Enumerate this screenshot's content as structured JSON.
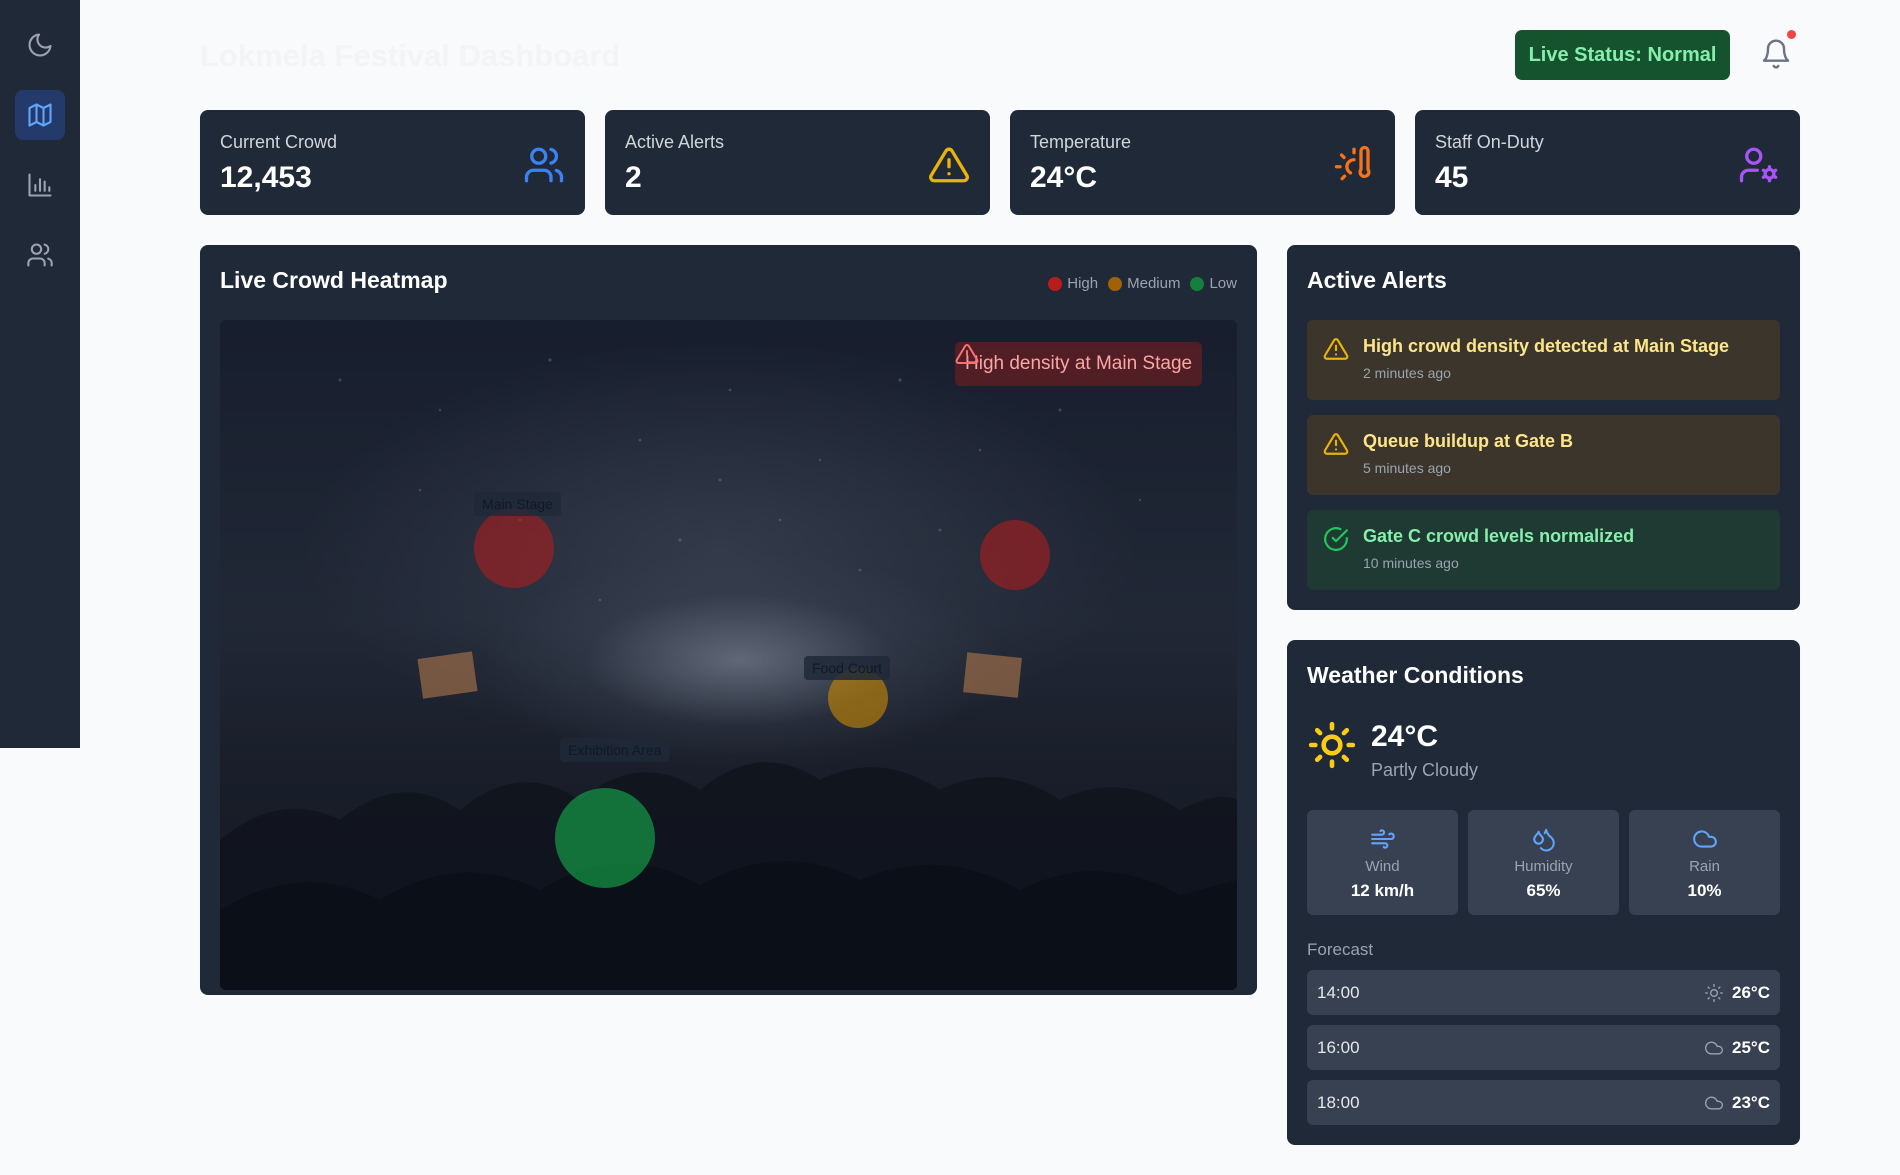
{
  "header": {
    "title": "Lokmela Festival Dashboard",
    "live_status": "Live Status: Normal"
  },
  "sidebar": {
    "items": [
      {
        "icon": "moon-icon"
      },
      {
        "icon": "map-icon",
        "active": true
      },
      {
        "icon": "bar-chart-icon"
      },
      {
        "icon": "users-icon"
      }
    ]
  },
  "stats": [
    {
      "label": "Current Crowd",
      "value": "12,453",
      "icon": "users-icon",
      "color": "#3b82f6"
    },
    {
      "label": "Active Alerts",
      "value": "2",
      "icon": "warning-icon",
      "color": "#eab308"
    },
    {
      "label": "Temperature",
      "value": "24°C",
      "icon": "thermometer-sun-icon",
      "color": "#f97316"
    },
    {
      "label": "Staff On-Duty",
      "value": "45",
      "icon": "user-cog-icon",
      "color": "#a855f7"
    }
  ],
  "heatmap": {
    "title": "Live Crowd Heatmap",
    "legend": [
      {
        "label": "High",
        "color": "#b91c1c"
      },
      {
        "label": "Medium",
        "color": "#a16207"
      },
      {
        "label": "Low",
        "color": "#15803d"
      }
    ],
    "zones": [
      {
        "label": "Main Stage",
        "level": "high"
      },
      {
        "label": "Food Court",
        "level": "medium"
      },
      {
        "label": "Exhibition Area",
        "level": "low"
      }
    ],
    "overlay_alert": "High density at Main Stage"
  },
  "alerts": {
    "title": "Active Alerts",
    "items": [
      {
        "title": "High crowd density detected at Main Stage",
        "time": "2 minutes ago",
        "type": "warning"
      },
      {
        "title": "Queue buildup at Gate B",
        "time": "5 minutes ago",
        "type": "warning"
      },
      {
        "title": "Gate C crowd levels normalized",
        "time": "10 minutes ago",
        "type": "success"
      }
    ]
  },
  "weather": {
    "title": "Weather Conditions",
    "temp": "24°C",
    "condition": "Partly Cloudy",
    "metrics": [
      {
        "label": "Wind",
        "value": "12 km/h",
        "icon": "wind-icon"
      },
      {
        "label": "Humidity",
        "value": "65%",
        "icon": "droplets-icon"
      },
      {
        "label": "Rain",
        "value": "10%",
        "icon": "cloud-icon"
      }
    ],
    "forecast_label": "Forecast",
    "forecast": [
      {
        "time": "14:00",
        "temp": "26°C",
        "icon": "sun-icon"
      },
      {
        "time": "16:00",
        "temp": "25°C",
        "icon": "cloud-icon"
      },
      {
        "time": "18:00",
        "temp": "23°C",
        "icon": "cloud-icon"
      }
    ]
  }
}
